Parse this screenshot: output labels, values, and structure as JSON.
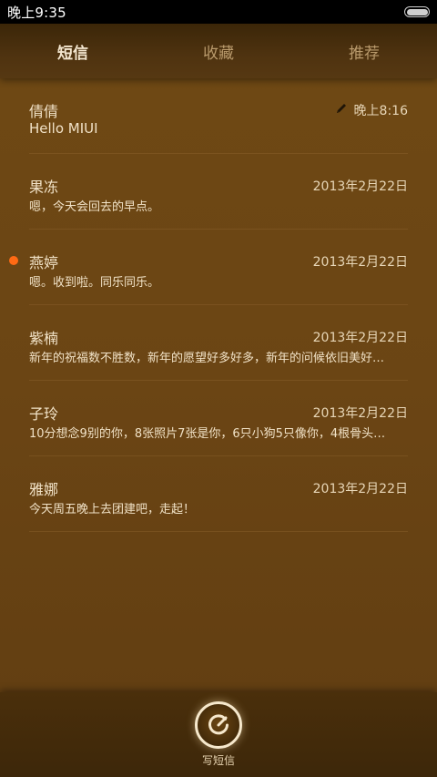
{
  "status_bar": {
    "time": "晚上9:35"
  },
  "tabs": [
    {
      "label": "短信",
      "active": true
    },
    {
      "label": "收藏",
      "active": false
    },
    {
      "label": "推荐",
      "active": false
    }
  ],
  "conversations": [
    {
      "name": "倩倩",
      "preview": "Hello MIUI",
      "date": "晚上8:16",
      "draft": true,
      "unread": false
    },
    {
      "name": "果冻",
      "preview": "嗯，今天会回去的早点。",
      "date": "2013年2月22日",
      "draft": false,
      "unread": false
    },
    {
      "name": "燕婷",
      "preview": "嗯。收到啦。同乐同乐。",
      "date": "2013年2月22日",
      "draft": false,
      "unread": true
    },
    {
      "name": "紫楠",
      "preview": "新年的祝福数不胜数，新年的愿望好多好多，新年的问候依旧美好…",
      "date": "2013年2月22日",
      "draft": false,
      "unread": false
    },
    {
      "name": "子玲",
      "preview": "10分想念9别的你，8张照片7张是你，6只小狗5只像你，4根骨头…",
      "date": "2013年2月22日",
      "draft": false,
      "unread": false
    },
    {
      "name": "雅娜",
      "preview": "今天周五晚上去团建吧，走起！",
      "date": "2013年2月22日",
      "draft": false,
      "unread": false
    }
  ],
  "compose": {
    "label": "写短信",
    "icon": "compose-icon"
  },
  "colors": {
    "unread_dot": "#ff6a14",
    "list_background": "#6b4514",
    "text": "#f1e2c7"
  }
}
